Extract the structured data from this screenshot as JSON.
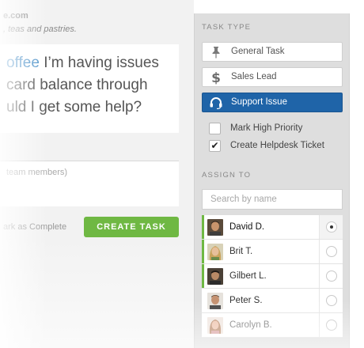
{
  "left": {
    "email_fragment": "e.com",
    "tagline_fragment": ", teas and pastries.",
    "message_lines": [
      {
        "link": "offee",
        "text": " I’m having issues"
      },
      {
        "link": "",
        "text": "card balance through"
      },
      {
        "link": "",
        "text": "uld I get some help?"
      }
    ],
    "assignee_placeholder": "team members)",
    "mark_complete_label": "ark as Complete",
    "create_task_label": "CREATE TASK"
  },
  "panel": {
    "task_type_label": "TASK TYPE",
    "task_types": [
      {
        "label": "General Task",
        "icon": "pin-icon",
        "active": false
      },
      {
        "label": "Sales Lead",
        "icon": "dollar-icon",
        "active": false
      },
      {
        "label": "Support Issue",
        "icon": "headset-icon",
        "active": true
      }
    ],
    "checks": [
      {
        "label": "Mark High Priority",
        "checked": false
      },
      {
        "label": "Create Helpdesk Ticket",
        "checked": true
      }
    ],
    "assign_to_label": "ASSIGN TO",
    "search_placeholder": "Search by name",
    "people": [
      {
        "name": "David D.",
        "selected": true,
        "bar": true
      },
      {
        "name": "Brit T.",
        "selected": false,
        "bar": true
      },
      {
        "name": "Gilbert L.",
        "selected": false,
        "bar": true
      },
      {
        "name": "Peter S.",
        "selected": false,
        "bar": false
      },
      {
        "name": "Carolyn B.",
        "selected": false,
        "bar": false
      }
    ]
  },
  "colors": {
    "accent_green": "#6fb843",
    "active_blue": "#1f64a8",
    "link_blue": "#4a90c8"
  }
}
